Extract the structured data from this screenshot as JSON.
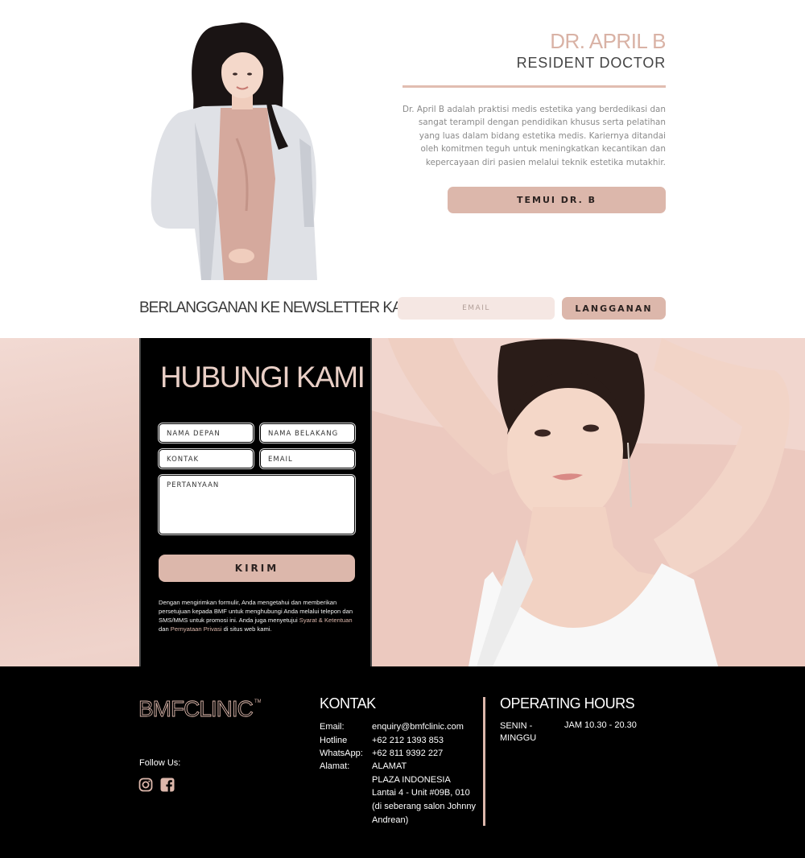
{
  "doctor": {
    "name": "DR. APRIL B",
    "role": "RESIDENT DOCTOR",
    "bio": "Dr. April B adalah praktisi medis estetika yang berdedikasi dan sangat terampil dengan pendidikan khusus serta pelatihan yang luas dalam bidang estetika medis. Kariernya ditandai oleh komitmen teguh untuk meningkatkan kecantikan dan kepercayaan diri pasien melalui teknik estetika mutakhir.",
    "button_label": "TEMUI DR. B"
  },
  "newsletter": {
    "title": "BERLANGGANAN KE NEWSLETTER KAMI",
    "email_placeholder": "EMAIL",
    "button_label": "LANGGANAN"
  },
  "contact_form": {
    "title": "HUBUNGI KAMI",
    "first_name_placeholder": "NAMA DEPAN",
    "last_name_placeholder": "NAMA BELAKANG",
    "contact_placeholder": "KONTAK",
    "email_placeholder": "EMAIL",
    "question_placeholder": "PERTANYAAN",
    "submit_label": "KIRIM",
    "disclaimer_pre": "Dengan mengirimkan formulir, Anda mengetahui dan memberikan persetujuan kepada BMF untuk menghubungi Anda melalui telepon dan SMS/MMS untuk promosi ini. Anda juga menyetujui ",
    "terms_link": "Syarat & Ketentuan",
    "disclaimer_mid": " dan ",
    "privacy_link": "Pernyataan Privasi",
    "disclaimer_post": " di situs web kami."
  },
  "footer": {
    "logo_text": "BMFCLINIC",
    "follow_label": "Follow Us:",
    "social_icons": [
      "instagram-icon",
      "facebook-icon"
    ],
    "kontak": {
      "title": "KONTAK",
      "email_label": "Email:",
      "email_value": "enquiry@bmfclinic.com",
      "hotline_label": "Hotline",
      "hotline_value": "+62 212 1393 853",
      "whatsapp_label": "WhatsApp:",
      "whatsapp_value": "+62 811 9392 227",
      "address_label": "Alamat:",
      "address_lines": [
        "ALAMAT",
        "PLAZA INDONESIA",
        "Lantai 4 - Unit #09B, 010",
        "(di seberang salon Johnny",
        "Andrean)"
      ]
    },
    "hours": {
      "title": "OPERATING HOURS",
      "day_line1": "SENIN -",
      "day_line2": "MINGGU",
      "time": "JAM 10.30 - 20.30"
    }
  },
  "colors": {
    "accent": "#dcb7ab",
    "accent_light": "#f5e7e3",
    "footer_bg": "#000000"
  }
}
